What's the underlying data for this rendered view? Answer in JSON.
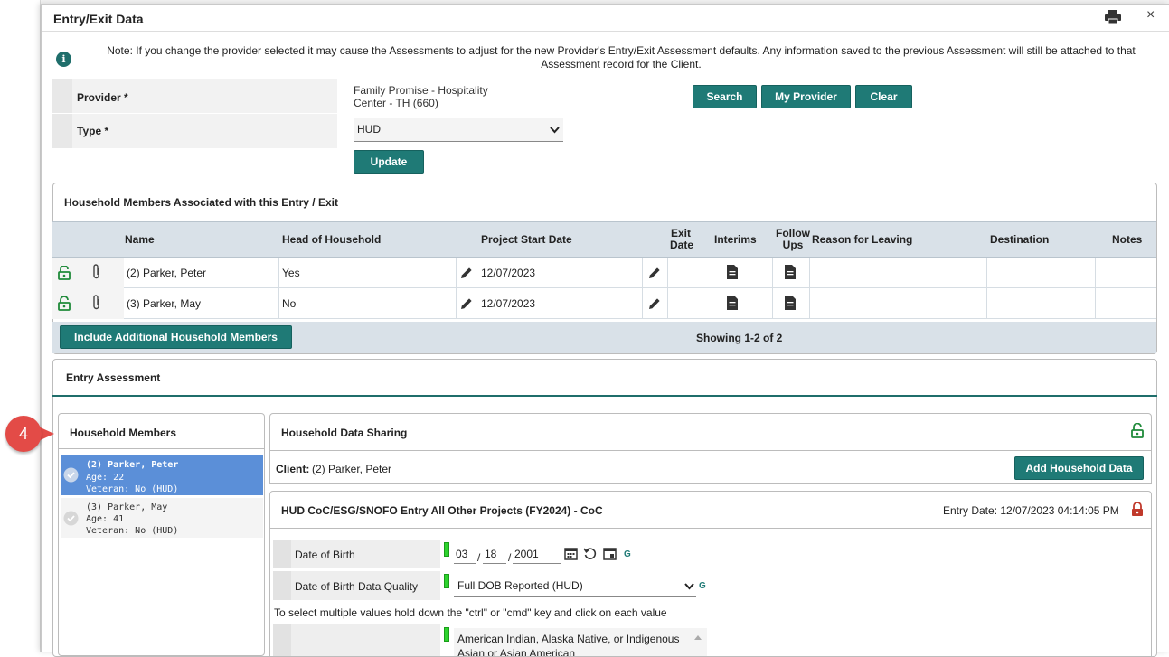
{
  "modal": {
    "title": "Entry/Exit Data",
    "close": "×"
  },
  "note": "Note: If you change the provider selected it may cause the Assessments to adjust for the new Provider's Entry/Exit Assessment defaults. Any information saved to the previous Assessment will still be attached to that Assessment record for the Client.",
  "info_icon": "i",
  "provider": {
    "label": "Provider *",
    "value_line1": "Family Promise - Hospitality",
    "value_line2": "Center - TH (660)",
    "search": "Search",
    "my_provider": "My Provider",
    "clear": "Clear"
  },
  "type": {
    "label": "Type *",
    "value": "HUD",
    "arrow": "⌄"
  },
  "update_button": "Update",
  "household_panel": {
    "title": "Household Members Associated with this Entry / Exit",
    "columns": {
      "name": "Name",
      "hoh": "Head of Household",
      "start": "Project Start Date",
      "exit_l1": "Exit",
      "exit_l2": "Date",
      "interims": "Interims",
      "follow_l1": "Follow",
      "follow_l2": "Ups",
      "reason": "Reason for Leaving",
      "destination": "Destination",
      "notes": "Notes"
    },
    "rows": [
      {
        "name": "(2) Parker, Peter",
        "hoh": "Yes",
        "start": "12/07/2023"
      },
      {
        "name": "(3) Parker, May",
        "hoh": "No",
        "start": "12/07/2023"
      }
    ],
    "include_button": "Include Additional Household Members",
    "showing": "Showing 1-2 of 2"
  },
  "entry_assessment": {
    "title": "Entry Assessment"
  },
  "step_badge": "4",
  "household_members": {
    "title": "Household Members",
    "items": [
      {
        "name": "(2) Parker, Peter",
        "age": "Age: 22",
        "veteran": "Veteran: No (HUD)",
        "selected": true
      },
      {
        "name": "(3) Parker, May",
        "age": "Age: 41",
        "veteran": "Veteran: No (HUD)",
        "selected": false
      }
    ]
  },
  "data_sharing": {
    "title": "Household Data Sharing",
    "client_label": "Client:",
    "client_value": "(2) Parker, Peter",
    "add_button": "Add Household Data"
  },
  "assessment": {
    "title": "HUD CoC/ESG/SNOFO Entry All Other Projects (FY2024) - CoC",
    "entry_date": "Entry Date: 12/07/2023 04:14:05 PM",
    "dob_label": "Date of Birth",
    "dob_month": "03",
    "dob_day": "18",
    "dob_year": "2001",
    "slash": "/",
    "dob_quality_label": "Date of Birth Data Quality",
    "dob_quality_value": "Full DOB Reported (HUD)",
    "g": "G",
    "multi_hint": "To select multiple values hold down the \"ctrl\" or \"cmd\" key and click on each value",
    "race_options": [
      "American Indian, Alaska Native, or Indigenous",
      "Asian or Asian American"
    ]
  },
  "colors": {
    "accent": "#1f7a76",
    "selected": "#5b8fd8",
    "lock_green": "#1f8a3a",
    "lock_red": "#c0392b",
    "badge": "#e34b47"
  }
}
